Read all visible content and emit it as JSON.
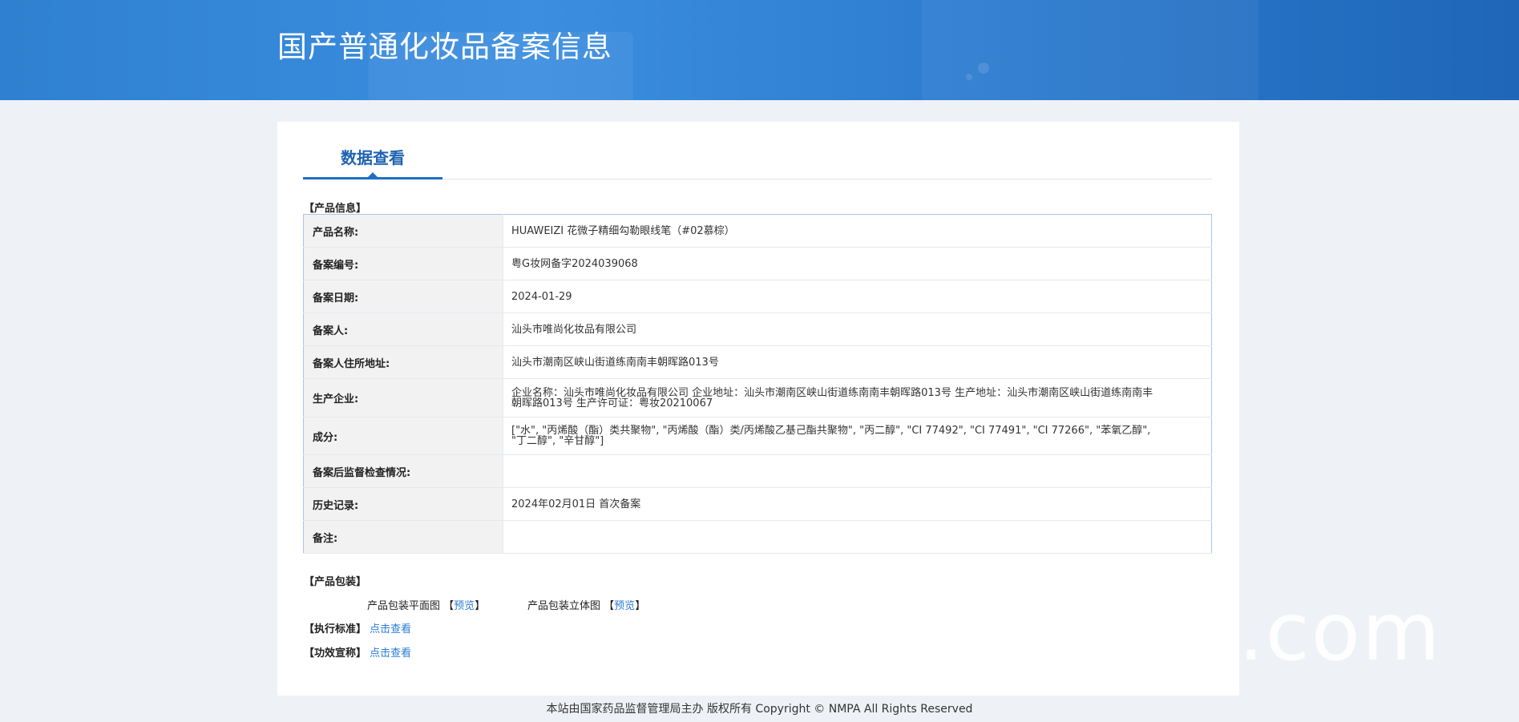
{
  "header": {
    "title": "国产普通化妆品备案信息"
  },
  "tabs": [
    {
      "label": "数据查看"
    }
  ],
  "sections": {
    "product_info": "【产品信息】",
    "packaging": "【产品包装】",
    "standard": "【执行标准】",
    "efficacy": "【功效宣称】"
  },
  "rows": [
    {
      "label": "产品名称:",
      "value": "HUAWEIZI 花微子精细勾勒眼线笔（#02慕棕）"
    },
    {
      "label": "备案编号:",
      "value": "粤G妆网备字2024039068"
    },
    {
      "label": "备案日期:",
      "value": "2024-01-29"
    },
    {
      "label": "备案人:",
      "value": "汕头市唯尚化妆品有限公司"
    },
    {
      "label": "备案人住所地址:",
      "value": "汕头市潮南区峡山街道练南南丰朝晖路013号"
    },
    {
      "label": "生产企业:",
      "value": "企业名称：汕头市唯尚化妆品有限公司 企业地址：汕头市潮南区峡山街道练南南丰朝晖路013号 生产地址：汕头市潮南区峡山街道练南南丰朝晖路013号 生产许可证：粤妆20210067"
    },
    {
      "label": "成分:",
      "value": "[\"水\", \"丙烯酸（酯）类共聚物\", \"丙烯酸（酯）类/丙烯酸乙基己酯共聚物\", \"丙二醇\", \"CI 77492\", \"CI 77491\", \"CI 77266\", \"苯氧乙醇\", \"丁二醇\", \"辛甘醇\"]"
    },
    {
      "label": "备案后监督检查情况:",
      "value": ""
    },
    {
      "label": "历史记录:",
      "value": "2024年02月01日 首次备案"
    },
    {
      "label": "备注:",
      "value": ""
    }
  ],
  "packaging": {
    "flat_label": "产品包装平面图",
    "stereo_label": "产品包装立体图",
    "preview": "预览",
    "bracket_open": "【",
    "bracket_close": "】"
  },
  "links": {
    "view": "点击查看"
  },
  "footer": {
    "text": "本站由国家药品监督管理局主办 版权所有 Copyright © NMPA All Rights Reserved"
  },
  "watermark": ".com"
}
